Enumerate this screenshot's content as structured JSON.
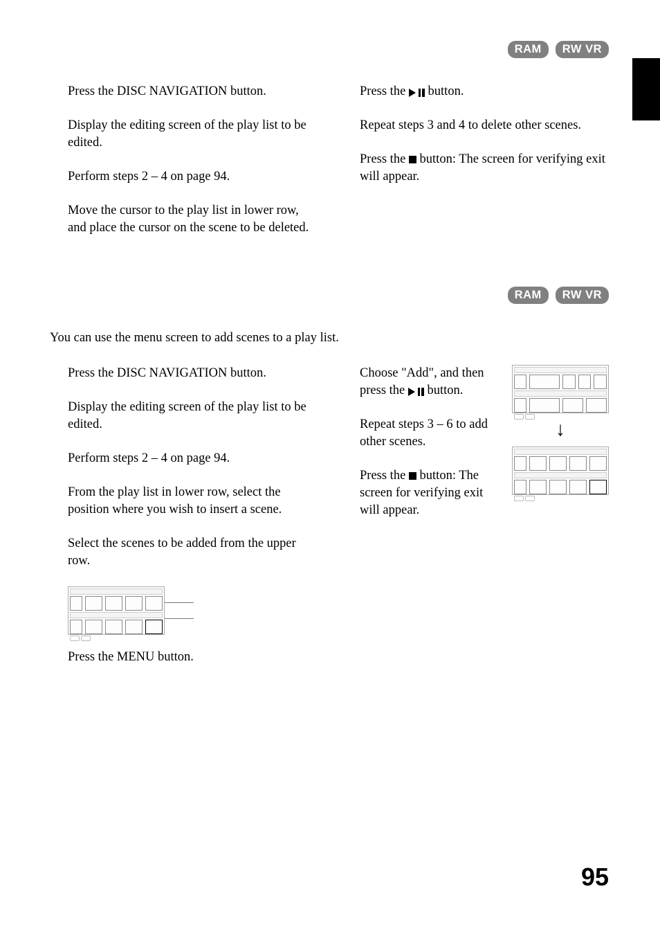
{
  "badges": {
    "ram": "RAM",
    "rwvr": "RW VR"
  },
  "section1": {
    "left": {
      "s1": "Press the DISC NAVIGATION button.",
      "s2": "Display the editing screen of the play list to be edited.",
      "s3": "Perform steps 2 – 4 on page 94.",
      "s4": "Move the cursor to the play list in lower row, and place the cursor on the scene to be deleted."
    },
    "right": {
      "s5a": "Press the ",
      "s5b": " button.",
      "s6": "Repeat steps 3 and 4 to delete other scenes.",
      "s7a": "Press the ",
      "s7b": " button: The screen for verifying exit will appear."
    }
  },
  "section2": {
    "intro": "You can use the menu screen to add scenes to a play list.",
    "left": {
      "s1": "Press the DISC NAVIGATION button.",
      "s2": "Display the editing screen of the play list to be edited.",
      "s3": "Perform steps 2 – 4 on page 94.",
      "s4": "From the play list in lower row, select the position where you wish to insert a scene.",
      "s5": "Select the scenes to be added from the upper row.",
      "s6": "Press the MENU button."
    },
    "right": {
      "s7a": "Choose \"Add\", and then press the ",
      "s7b": " button.",
      "s8": "Repeat steps 3 – 6 to add other scenes.",
      "s9a": "Press the ",
      "s9b": " button: The screen for verifying exit will appear."
    }
  },
  "pageNumber": "95"
}
